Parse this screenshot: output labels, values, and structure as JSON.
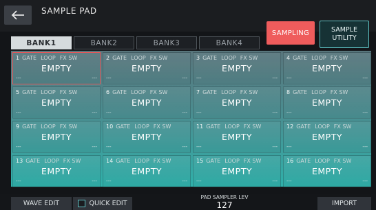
{
  "header": {
    "title": "SAMPLE PAD"
  },
  "tabs": [
    {
      "label": "BANK1"
    },
    {
      "label": "BANK2"
    },
    {
      "label": "BANK3"
    },
    {
      "label": "BANK4"
    }
  ],
  "buttons": {
    "sampling": "SAMPLING",
    "utility_line1": "SAMPLE",
    "utility_line2": "UTILITY"
  },
  "pad_options": [
    "GATE",
    "LOOP",
    "FX SW"
  ],
  "pads": [
    {
      "num": "1",
      "name": "EMPTY",
      "left": "---",
      "right": "---"
    },
    {
      "num": "2",
      "name": "EMPTY",
      "left": "---",
      "right": "---"
    },
    {
      "num": "3",
      "name": "EMPTY",
      "left": "---",
      "right": "---"
    },
    {
      "num": "4",
      "name": "EMPTY",
      "left": "---",
      "right": "---"
    },
    {
      "num": "5",
      "name": "EMPTY",
      "left": "---",
      "right": "---"
    },
    {
      "num": "6",
      "name": "EMPTY",
      "left": "---",
      "right": "---"
    },
    {
      "num": "7",
      "name": "EMPTY",
      "left": "---",
      "right": "---"
    },
    {
      "num": "8",
      "name": "EMPTY",
      "left": "---",
      "right": "---"
    },
    {
      "num": "9",
      "name": "EMPTY",
      "left": "---",
      "right": "---"
    },
    {
      "num": "10",
      "name": "EMPTY",
      "left": "---",
      "right": "---"
    },
    {
      "num": "11",
      "name": "EMPTY",
      "left": "---",
      "right": "---"
    },
    {
      "num": "12",
      "name": "EMPTY",
      "left": "---",
      "right": "---"
    },
    {
      "num": "13",
      "name": "EMPTY",
      "left": "---",
      "right": "---"
    },
    {
      "num": "14",
      "name": "EMPTY",
      "left": "---",
      "right": "---"
    },
    {
      "num": "15",
      "name": "EMPTY",
      "left": "---",
      "right": "---"
    },
    {
      "num": "16",
      "name": "EMPTY",
      "left": "---",
      "right": "---"
    }
  ],
  "footer": {
    "wave_edit": "WAVE EDIT",
    "quick_edit": "QUICK EDIT",
    "level_label": "PAD SAMPLER LEV",
    "level_value": "127",
    "import": "IMPORT"
  },
  "colors": {
    "accent": "#5fc2c4",
    "sampling": "#ef5c5c",
    "selected_pad": "#e2585a"
  }
}
